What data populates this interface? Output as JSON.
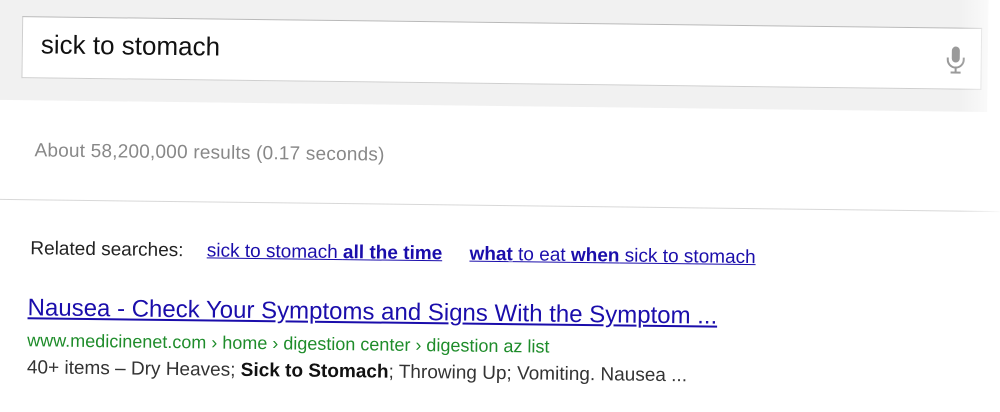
{
  "search": {
    "query": "sick to stomach",
    "mic_icon": "microphone-icon"
  },
  "stats": {
    "text": "About 58,200,000 results (0.17 seconds)"
  },
  "related": {
    "label": "Related searches:",
    "items": [
      {
        "prefix": "sick to stomach ",
        "bold": "all the time",
        "suffix": ""
      },
      {
        "prefix": "",
        "bold": "what",
        "middle": " to eat ",
        "bold2": "when",
        "suffix": " sick to stomach"
      }
    ]
  },
  "result": {
    "title": "Nausea - Check Your Symptoms and Signs With the Symptom ...",
    "url": "www.medicinenet.com › home › digestion center › digestion az list",
    "snippet_prefix": "40+ items – Dry Heaves; ",
    "snippet_bold": "Sick to Stomach",
    "snippet_suffix": "; Throwing Up; Vomiting. Nausea ..."
  },
  "colors": {
    "link": "#1a0dab",
    "url": "#1e8c2a",
    "stats": "#888888",
    "band": "#f1f1f1"
  }
}
